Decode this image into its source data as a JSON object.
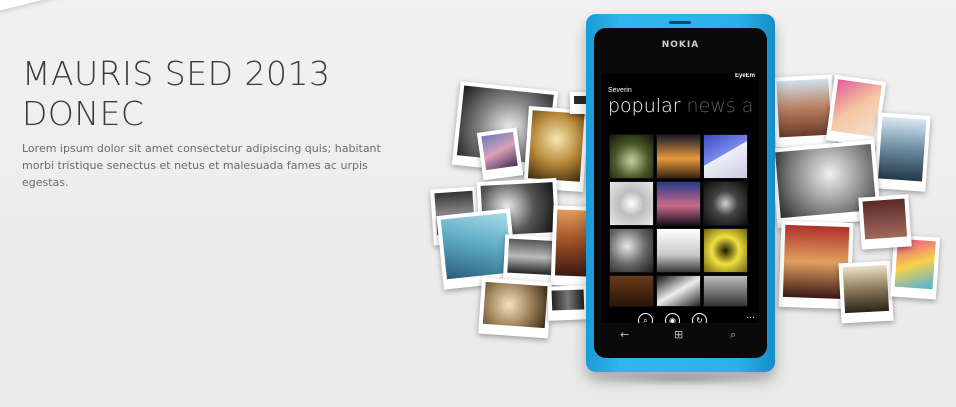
{
  "hero": {
    "title_line1": "MAURIS SED 2013",
    "title_line2": "DONEC",
    "body": "Lorem ipsum dolor sit amet consectetur adipiscing quis; habitant morbi tristique senectus et netus et malesuada fames ac urpis egestas."
  },
  "phone": {
    "brand": "NOKIA",
    "app_name": "EyeEm",
    "user": "Severin",
    "pivot": [
      {
        "label": "popular",
        "active": true
      },
      {
        "label": "news",
        "active": false
      },
      {
        "label": "a",
        "active": false
      }
    ],
    "appbar": [
      {
        "icon": "search-icon",
        "glyph": "⌕"
      },
      {
        "icon": "camera-icon",
        "glyph": "◉"
      },
      {
        "icon": "refresh-icon",
        "glyph": "↻"
      }
    ],
    "appbar_more": "...",
    "hardware_keys": [
      {
        "icon": "back-icon",
        "glyph": "←"
      },
      {
        "icon": "windows-icon",
        "glyph": "⊞"
      },
      {
        "icon": "search-key-icon",
        "glyph": "⌕"
      }
    ]
  }
}
